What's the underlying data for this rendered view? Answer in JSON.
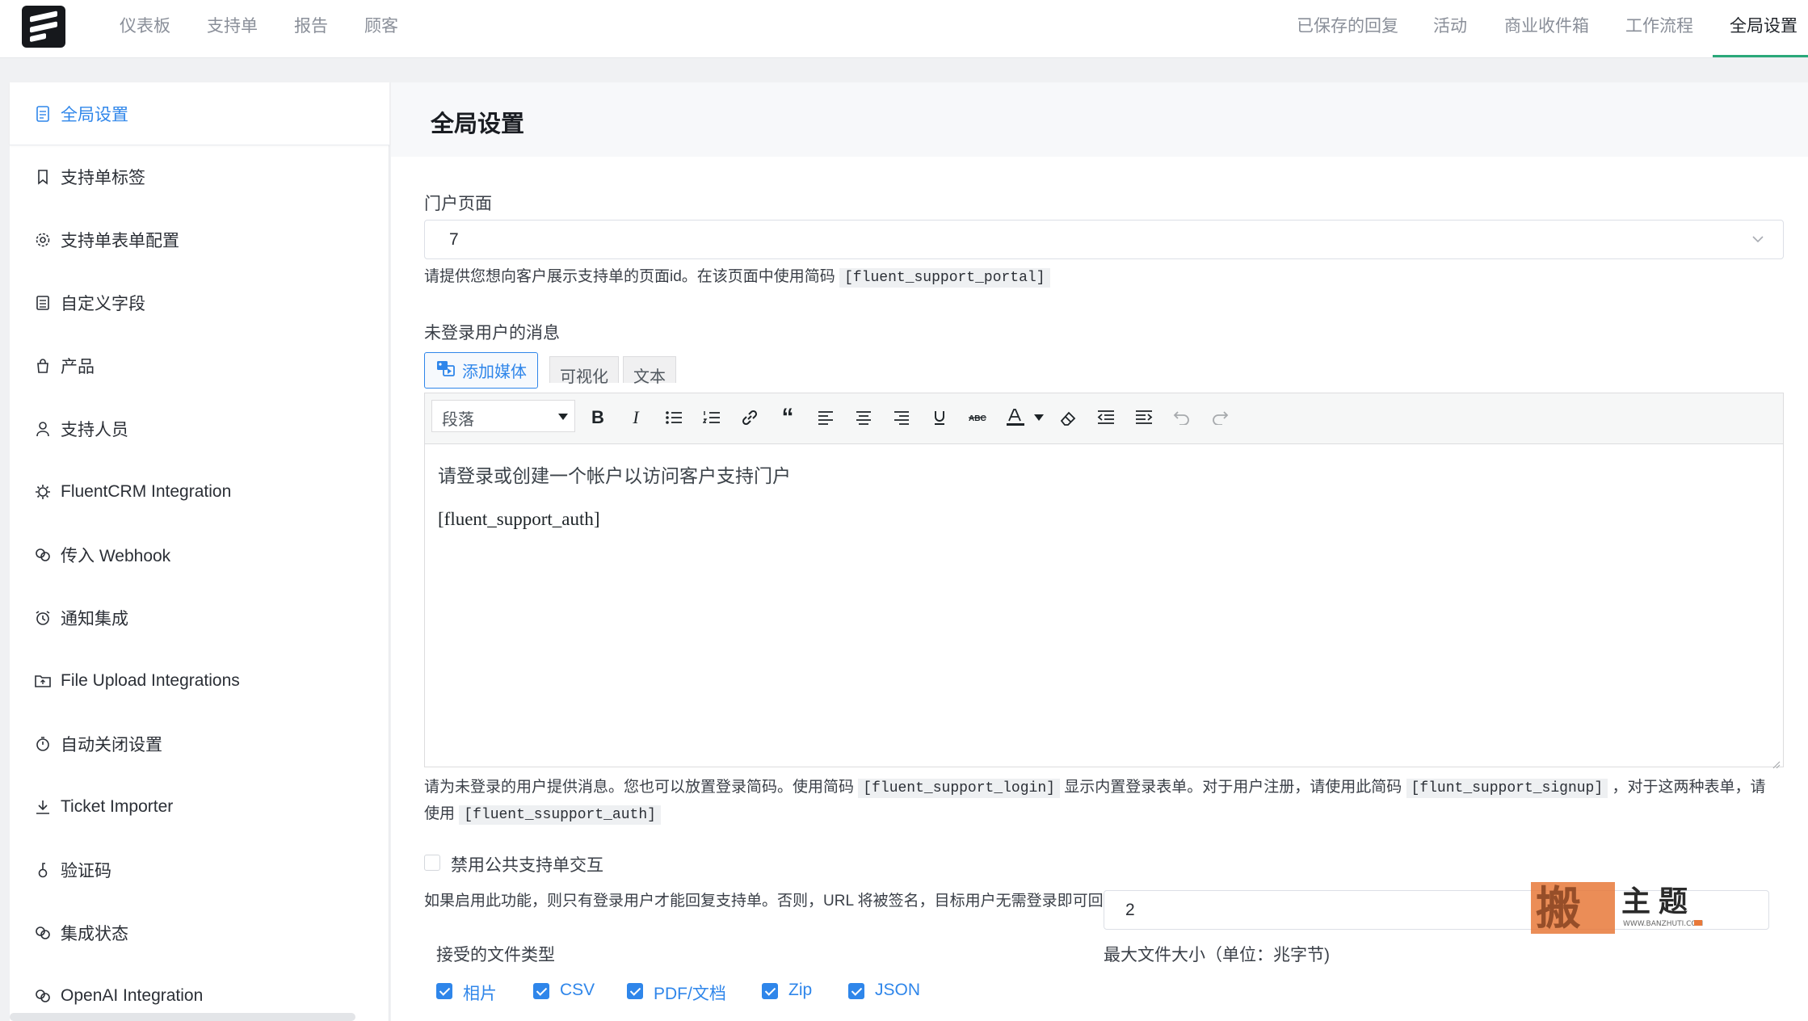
{
  "topnav": {
    "left": [
      "仪表板",
      "支持单",
      "报告",
      "顾客"
    ],
    "right": [
      "已保存的回复",
      "活动",
      "商业收件箱",
      "工作流程",
      "全局设置"
    ],
    "active": "全局设置"
  },
  "sidebar": {
    "items": [
      {
        "label": "全局设置",
        "icon": "document-icon",
        "active": true
      },
      {
        "label": "支持单标签",
        "icon": "bookmark-icon"
      },
      {
        "label": "支持单表单配置",
        "icon": "gear-icon"
      },
      {
        "label": "自定义字段",
        "icon": "list-icon"
      },
      {
        "label": "产品",
        "icon": "bag-icon"
      },
      {
        "label": "支持人员",
        "icon": "user-icon"
      },
      {
        "label": "FluentCRM Integration",
        "icon": "cog-icon"
      },
      {
        "label": "传入 Webhook",
        "icon": "link-icon"
      },
      {
        "label": "通知集成",
        "icon": "alarm-icon"
      },
      {
        "label": "File Upload Integrations",
        "icon": "folder-icon"
      },
      {
        "label": "自动关闭设置",
        "icon": "timer-icon"
      },
      {
        "label": "Ticket Importer",
        "icon": "download-icon"
      },
      {
        "label": "验证码",
        "icon": "key-icon"
      },
      {
        "label": "集成状态",
        "icon": "link-icon"
      },
      {
        "label": "OpenAI Integration",
        "icon": "link-icon"
      }
    ]
  },
  "main": {
    "title": "全局设置",
    "portal": {
      "label": "门户页面",
      "value": "7",
      "help_text": "请提供您想向客户展示支持单的页面id。在该页面中使用简码",
      "help_code": "[fluent_support_portal]"
    },
    "message": {
      "label": "未登录用户的消息",
      "add_media": "添加媒体",
      "tab_visual": "可视化",
      "tab_text": "文本",
      "format": "段落",
      "line1": "请登录或创建一个帐户以访问客户支持门户",
      "line2": "[fluent_support_auth]",
      "help_a": "请为未登录的用户提供消息。您也可以放置登录简码。使用简码",
      "code_login": "[fluent_support_login]",
      "help_b": "显示内置登录表单。对于用户注册，请使用此简码",
      "code_signup": "[flunt_support_signup]",
      "help_c": "，对于这两种表单，请",
      "help_d": "使用",
      "code_auth": "[fluent_ssupport_auth]"
    },
    "disable_public": {
      "label": "禁用公共支持单交互",
      "checked": false,
      "help": "如果启用此功能，则只有登录用户才能回复支持单。否则，URL 将被签名，目标用户无需登录即可回复"
    },
    "file_types": {
      "label": "接受的文件类型",
      "options": [
        "相片",
        "CSV",
        "PDF/文档",
        "Zip",
        "JSON"
      ]
    },
    "max_size": {
      "label": "最大文件大小（单位：兆字节)",
      "value": "2"
    }
  },
  "watermark": {
    "text": "搬 主 题",
    "url": "WWW.BANZHUTI.COM"
  },
  "colors": {
    "accent": "#2f86ea",
    "nav_active_underline": "#2aa879"
  }
}
